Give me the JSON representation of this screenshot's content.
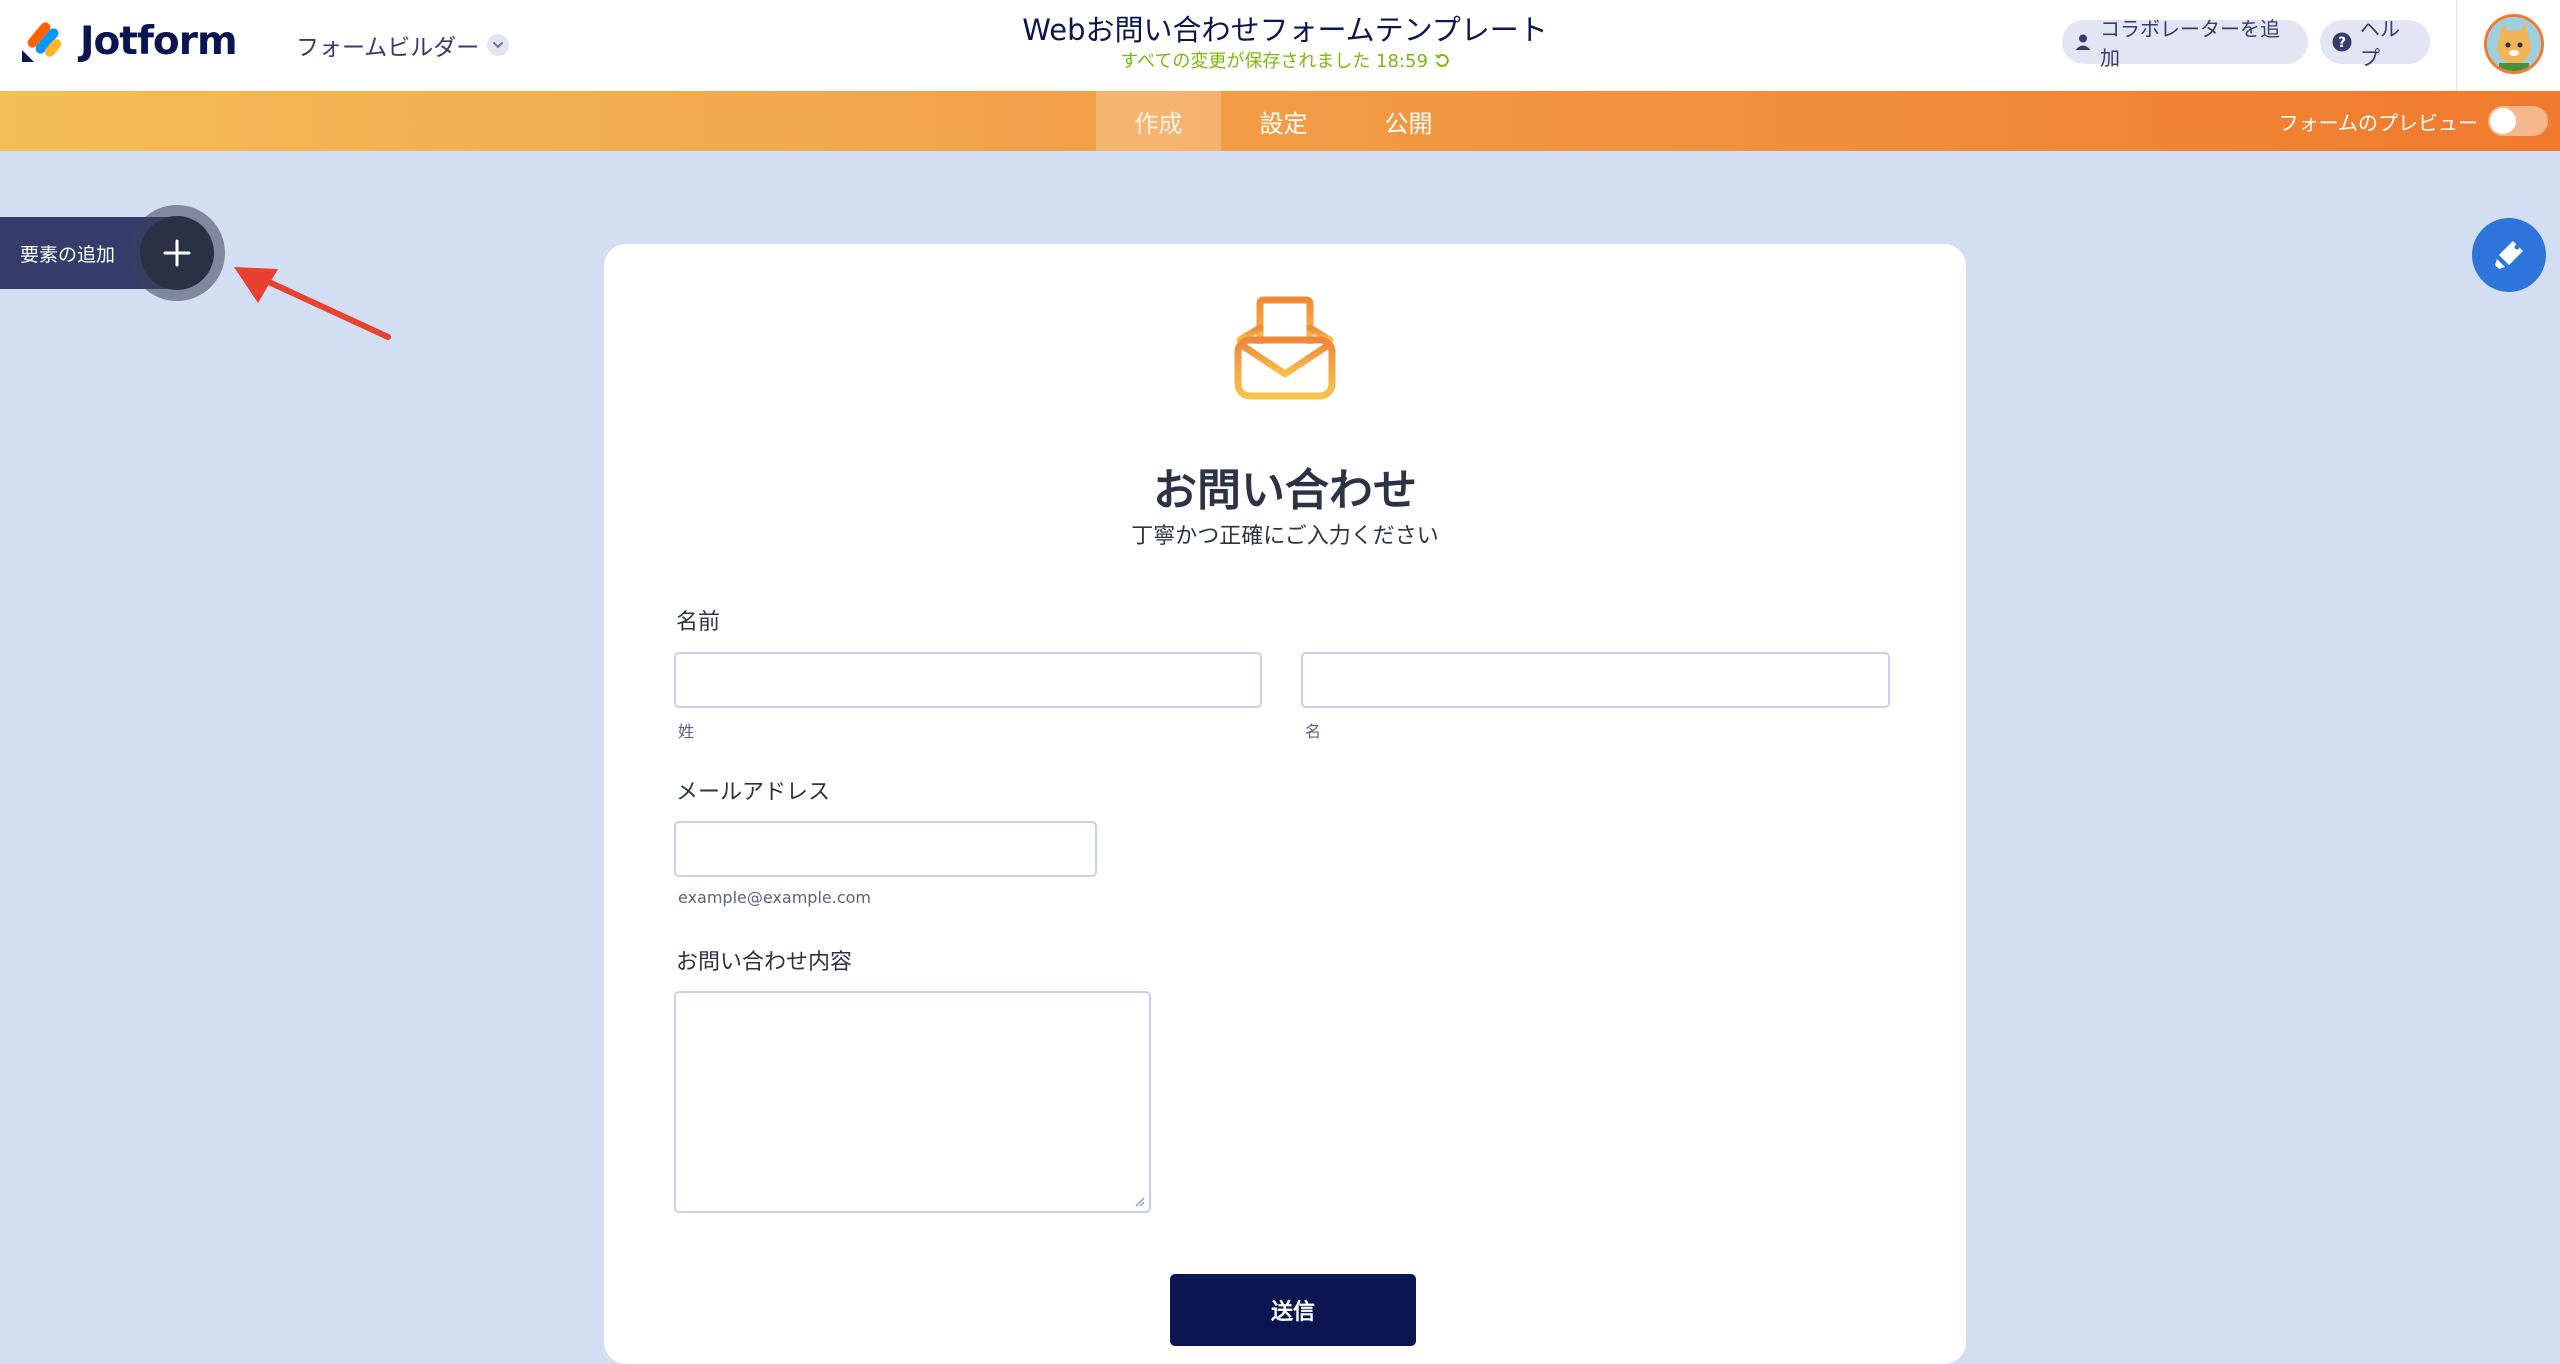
{
  "app": {
    "logo_text": "Jotform",
    "builder_label": "フォームビルダー"
  },
  "header": {
    "form_title": "Webお問い合わせフォームテンプレート",
    "save_status": "すべての変更が保存されました 18:59",
    "collaborator_label": "コラボレーターを追加",
    "help_label": "ヘルプ"
  },
  "nav": {
    "tabs": [
      {
        "label": "作成",
        "active": true
      },
      {
        "label": "設定",
        "active": false
      },
      {
        "label": "公開",
        "active": false
      }
    ],
    "preview_label": "フォームのプレビュー",
    "preview_on": false
  },
  "sidebar": {
    "add_element_label": "要素の追加"
  },
  "form": {
    "heading": "お問い合わせ",
    "subheading": "丁寧かつ正確にご入力ください",
    "name_label": "名前",
    "last_name_sublabel": "姓",
    "first_name_sublabel": "名",
    "email_label": "メールアドレス",
    "email_sublabel": "example@example.com",
    "message_label": "お問い合わせ内容",
    "submit_label": "送信"
  },
  "colors": {
    "brand_navy": "#0a1551",
    "nav_orange_start": "#f4bd57",
    "nav_orange_end": "#f07a2d",
    "saved_green": "#78bb07",
    "canvas_bg": "#d3def2",
    "paint_blue": "#2e75db",
    "arrow_red": "#e8412f"
  }
}
